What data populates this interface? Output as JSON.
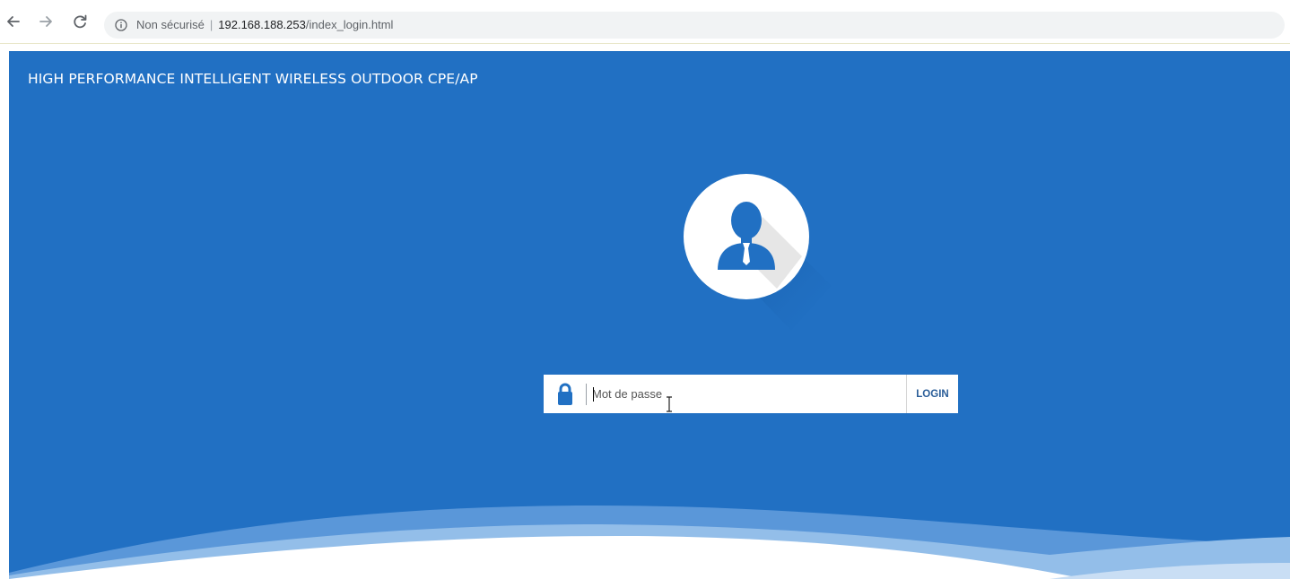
{
  "browser": {
    "back_icon": "arrow-left-icon",
    "forward_icon": "arrow-right-icon",
    "reload_icon": "reload-icon",
    "security_icon": "info-circle-icon",
    "security_label": "Non sécurisé",
    "url_separator": "|",
    "url_host": "192.168.188.253",
    "url_path": "/index_login.html"
  },
  "page": {
    "title": "HIGH PERFORMANCE INTELLIGENT WIRELESS OUTDOOR CPE/AP",
    "avatar_icon": "user-avatar-icon",
    "background_color": "#2170c3",
    "accent_color": "#2a5d98"
  },
  "login": {
    "lock_icon": "lock-icon",
    "password_placeholder": "Mot de passe",
    "password_value": "",
    "login_label": "LOGIN"
  }
}
